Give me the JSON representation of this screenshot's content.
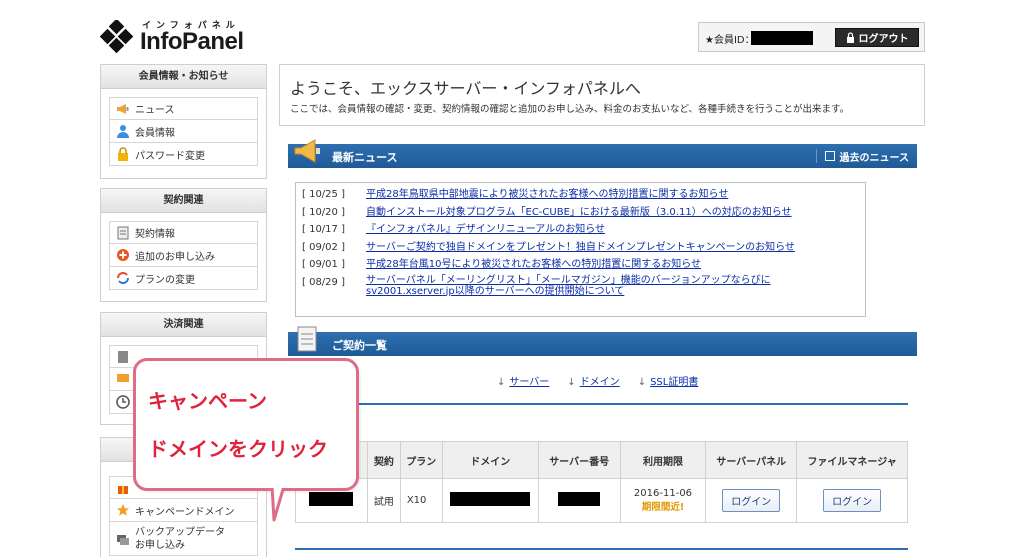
{
  "header": {
    "logo_kana": "インフォパネル",
    "logo_name": "InfoPanel",
    "member_label": "★会員ID：",
    "logout_label": "ログアウト"
  },
  "sidebar": {
    "section1": {
      "title": "会員情報・お知らせ",
      "items": [
        {
          "label": "ニュース",
          "icon": "megaphone-icon"
        },
        {
          "label": "会員情報",
          "icon": "person-icon"
        },
        {
          "label": "パスワード変更",
          "icon": "lock-icon"
        }
      ]
    },
    "section2": {
      "title": "契約関連",
      "items": [
        {
          "label": "契約情報",
          "icon": "document-icon"
        },
        {
          "label": "追加のお申し込み",
          "icon": "plus-circle-icon"
        },
        {
          "label": "プランの変更",
          "icon": "refresh-icon"
        }
      ]
    },
    "section3": {
      "title": "決済関連"
    },
    "section4": {
      "items": [
        {
          "label": "キャンペーンドメイン",
          "icon": "star-icon"
        },
        {
          "label": "バックアップデータ",
          "label2": "お申し込み",
          "icon": "backup-icon"
        }
      ]
    }
  },
  "welcome": {
    "title": "ようこそ、エックスサーバー・インフォパネルへ",
    "subtitle": "ここでは、会員情報の確認・変更、契約情報の確認と追加のお申し込み、料金のお支払いなど、各種手続きを行うことが出来ます。"
  },
  "news": {
    "title": "最新ニュース",
    "past_label": "過去のニュース",
    "items": [
      {
        "date": "[ 10/25 ]",
        "text": "平成28年鳥取県中部地震により被災されたお客様への特別措置に関するお知らせ"
      },
      {
        "date": "[ 10/20 ]",
        "text": "自動インストール対象プログラム「EC-CUBE」における最新版（3.0.11）への対応のお知らせ"
      },
      {
        "date": "[ 10/17 ]",
        "text": "『インフォパネル』デザインリニューアルのお知らせ"
      },
      {
        "date": "[ 09/02 ]",
        "text": "サーバーご契約で独自ドメインをプレゼント！独自ドメインプレゼントキャンペーンのお知らせ"
      },
      {
        "date": "[ 09/01 ]",
        "text": "平成28年台風10号により被災されたお客様への特別措置に関するお知らせ"
      },
      {
        "date": "[ 08/29 ]",
        "text": "サーバーパネル「メーリングリスト」「メールマガジン」機能のバージョンアップならびにsv2001.xserver.jp以降のサーバーへの提供開始について"
      }
    ]
  },
  "contracts": {
    "title": "ご契約一覧",
    "anchors": [
      "サーバー",
      "ドメイン",
      "SSL証明書"
    ],
    "headers": [
      "契約",
      "プラン",
      "ドメイン",
      "サーバー番号",
      "利用期限",
      "サーバーパネル",
      "ファイルマネージャ"
    ],
    "row": {
      "status": "試用",
      "plan": "X10",
      "expiry": "2016-11-06",
      "expiry_warning": "期限間近!",
      "server_panel_btn": "ログイン",
      "file_manager_btn": "ログイン"
    }
  },
  "callout": {
    "line1": "キャンペーン",
    "line2": "ドメインをクリック"
  },
  "colors": {
    "accent_blue": "#1f5a97",
    "callout_border": "#e06b86",
    "callout_text": "#e0233d",
    "warning": "#e39a00"
  }
}
